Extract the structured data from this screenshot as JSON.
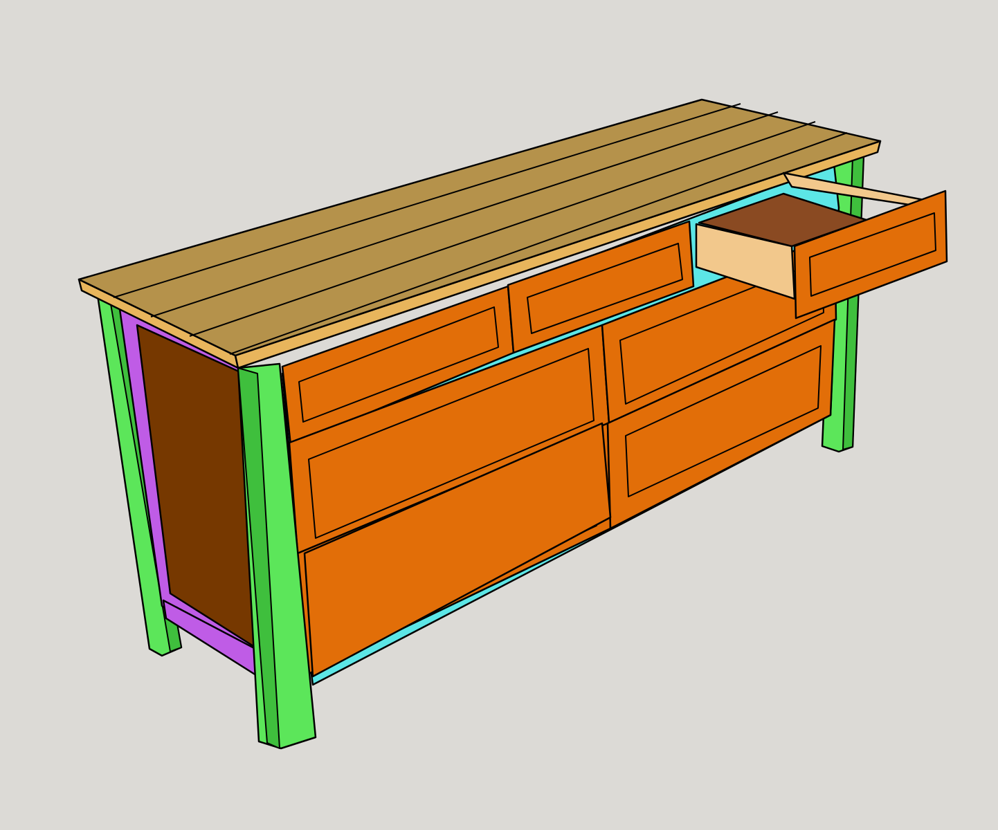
{
  "scene": {
    "subject": "",
    "background": "#dcdad6"
  },
  "colors": {
    "top_planks": "#b5924b",
    "top_edge": "#e8b55c",
    "legs": "#5ce65a",
    "leg_shadow": "#3fbf3d",
    "side_rails": "#bf5ce6",
    "side_panel": "#763800",
    "front_frame": "#5ce6e6",
    "drawer_front": "#e26e08",
    "drawer_box": "#f2c88c",
    "drawer_bottom": "#8a4a22"
  },
  "parts": {
    "top_planks": 5,
    "legs": 4,
    "drawers": 8,
    "open_drawers": 1
  }
}
